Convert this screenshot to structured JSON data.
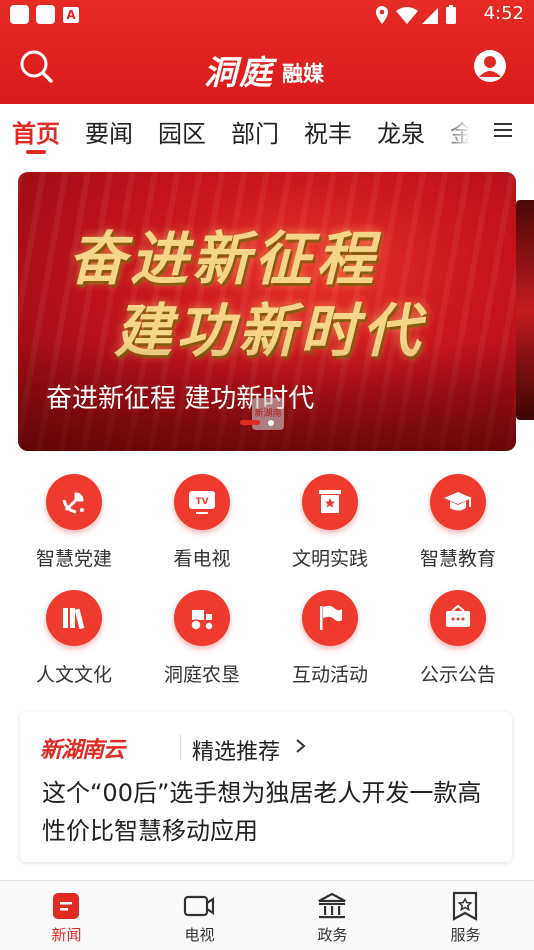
{
  "status_bar": {
    "time": "4:52",
    "notification_badge": "A"
  },
  "header": {
    "logo_script": "洞庭",
    "logo_text": "融媒"
  },
  "tabs": [
    {
      "label": "首页",
      "active": true
    },
    {
      "label": "要闻",
      "active": false
    },
    {
      "label": "园区",
      "active": false
    },
    {
      "label": "部门",
      "active": false
    },
    {
      "label": "祝丰",
      "active": false
    },
    {
      "label": "龙泉",
      "active": false
    },
    {
      "label": "金",
      "active": false
    }
  ],
  "banner": {
    "line1": "奋进新征程",
    "line2": "建功新时代",
    "caption": "奋进新征程 建功新时代",
    "stamp": "新湖南"
  },
  "grid_items": [
    {
      "label": "智慧党建",
      "icon": "party-emblem-icon"
    },
    {
      "label": "看电视",
      "icon": "tv-icon"
    },
    {
      "label": "文明实践",
      "icon": "flag-badge-icon"
    },
    {
      "label": "智慧教育",
      "icon": "graduation-cap-icon"
    },
    {
      "label": "人文文化",
      "icon": "books-icon"
    },
    {
      "label": "洞庭农垦",
      "icon": "tractor-icon"
    },
    {
      "label": "互动活动",
      "icon": "flag-icon"
    },
    {
      "label": "公示公告",
      "icon": "notice-board-icon"
    }
  ],
  "news_card": {
    "brand": "新湖南云",
    "section": "精选推荐",
    "headline": "这个“00后”选手想为独居老人开发一款高性价比智慧移动应用"
  },
  "bottom_nav": [
    {
      "label": "新闻",
      "icon": "news-icon",
      "active": true
    },
    {
      "label": "电视",
      "icon": "video-camera-icon",
      "active": false
    },
    {
      "label": "政务",
      "icon": "government-icon",
      "active": false
    },
    {
      "label": "服务",
      "icon": "service-icon",
      "active": false
    }
  ],
  "colors": {
    "brand_red": "#e02a24",
    "icon_red": "#ef3a30"
  }
}
